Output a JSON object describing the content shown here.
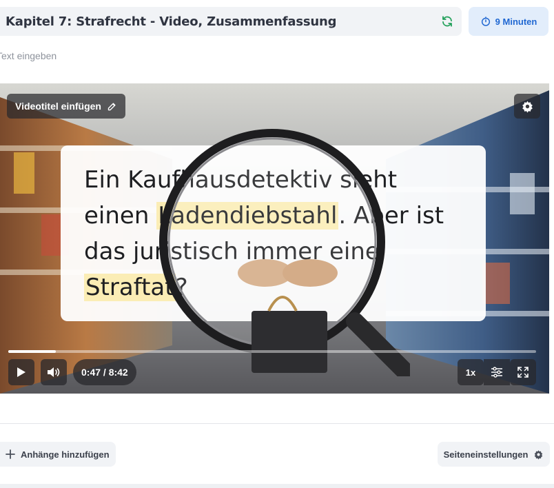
{
  "header": {
    "title": "Kapitel 7: Strafrecht - Video, Zusammenfassung",
    "duration_label": "9 Minuten",
    "sync_icon": "refresh-icon",
    "duration_icon": "timer-icon",
    "accent_color": "#1f67d2",
    "sync_color": "#22a05a"
  },
  "text_input": {
    "placeholder": "Text eingeben",
    "value": ""
  },
  "video": {
    "title_chip_label": "Videotitel einfügen",
    "caption": {
      "part1": "Ein Kaufhausdetektiv sieht einen ",
      "highlight1": "Ladendiebstahl",
      "part2": ". Aber ist das juristisch immer eine ",
      "highlight2": "Straftat",
      "part3": "?"
    },
    "time_display": "0:47 / 8:42",
    "progress_fraction": 0.09,
    "speed_label": "1x",
    "highlight_color": "#fbedb5"
  },
  "footer": {
    "attach_label": "Anhänge hinzufügen",
    "page_settings_label": "Seiteneinstellungen"
  }
}
